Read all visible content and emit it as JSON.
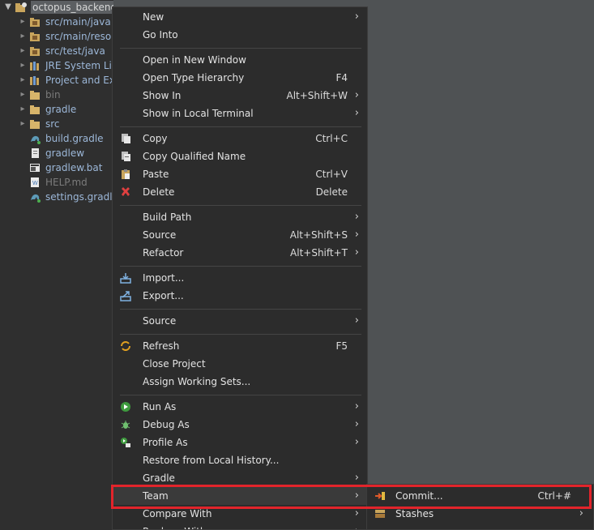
{
  "explorer": {
    "root": {
      "label": "octopus_backend [boot] [devtools] [octopus_backend main]"
    },
    "items": [
      {
        "label": "src/main/java",
        "icon": "source-folder-icon",
        "dim": false
      },
      {
        "label": "src/main/resources",
        "icon": "source-folder-icon",
        "dim": false
      },
      {
        "label": "src/test/java",
        "icon": "source-folder-icon",
        "dim": false
      },
      {
        "label": "JRE System Library",
        "icon": "library-icon",
        "dim": false
      },
      {
        "label": "Project and External Dependencies",
        "icon": "library-icon",
        "dim": false
      },
      {
        "label": "bin",
        "icon": "folder-icon",
        "dim": true
      },
      {
        "label": "gradle",
        "icon": "folder-icon",
        "dim": false
      },
      {
        "label": "src",
        "icon": "folder-icon",
        "dim": false
      },
      {
        "label": "build.gradle",
        "icon": "gradle-file-icon",
        "dim": false
      },
      {
        "label": "gradlew",
        "icon": "file-icon",
        "dim": false
      },
      {
        "label": "gradlew.bat",
        "icon": "bat-file-icon",
        "dim": false
      },
      {
        "label": "HELP.md",
        "icon": "markdown-file-icon",
        "dim": true
      },
      {
        "label": "settings.gradle",
        "icon": "gradle-file-icon",
        "dim": false
      }
    ]
  },
  "menu": {
    "items": [
      {
        "label": "New",
        "accel": "",
        "submenu": true,
        "icon": ""
      },
      {
        "label": "Go Into",
        "accel": "",
        "submenu": false,
        "icon": ""
      },
      {
        "label": "Open in New Window",
        "accel": "",
        "submenu": false,
        "icon": ""
      },
      {
        "label": "Open Type Hierarchy",
        "accel": "F4",
        "submenu": false,
        "icon": ""
      },
      {
        "label": "Show In",
        "accel": "Alt+Shift+W",
        "submenu": true,
        "icon": ""
      },
      {
        "label": "Show in Local Terminal",
        "accel": "",
        "submenu": true,
        "icon": ""
      },
      {
        "label": "Copy",
        "accel": "Ctrl+C",
        "submenu": false,
        "icon": "copy-icon"
      },
      {
        "label": "Copy Qualified Name",
        "accel": "",
        "submenu": false,
        "icon": "copy-qualified-name-icon"
      },
      {
        "label": "Paste",
        "accel": "Ctrl+V",
        "submenu": false,
        "icon": "paste-icon"
      },
      {
        "label": "Delete",
        "accel": "Delete",
        "submenu": false,
        "icon": "delete-icon"
      },
      {
        "label": "Build Path",
        "accel": "",
        "submenu": true,
        "icon": ""
      },
      {
        "label": "Source",
        "accel": "Alt+Shift+S",
        "submenu": true,
        "icon": ""
      },
      {
        "label": "Refactor",
        "accel": "Alt+Shift+T",
        "submenu": true,
        "icon": ""
      },
      {
        "label": "Import...",
        "accel": "",
        "submenu": false,
        "icon": "import-icon"
      },
      {
        "label": "Export...",
        "accel": "",
        "submenu": false,
        "icon": "export-icon"
      },
      {
        "label": "Source",
        "accel": "",
        "submenu": true,
        "icon": ""
      },
      {
        "label": "Refresh",
        "accel": "F5",
        "submenu": false,
        "icon": "refresh-icon"
      },
      {
        "label": "Close Project",
        "accel": "",
        "submenu": false,
        "icon": ""
      },
      {
        "label": "Assign Working Sets...",
        "accel": "",
        "submenu": false,
        "icon": ""
      },
      {
        "label": "Run As",
        "accel": "",
        "submenu": true,
        "icon": "run-icon"
      },
      {
        "label": "Debug As",
        "accel": "",
        "submenu": true,
        "icon": "debug-icon"
      },
      {
        "label": "Profile As",
        "accel": "",
        "submenu": true,
        "icon": "profile-icon"
      },
      {
        "label": "Restore from Local History...",
        "accel": "",
        "submenu": false,
        "icon": ""
      },
      {
        "label": "Gradle",
        "accel": "",
        "submenu": true,
        "icon": ""
      },
      {
        "label": "Team",
        "accel": "",
        "submenu": true,
        "icon": ""
      },
      {
        "label": "Compare With",
        "accel": "",
        "submenu": true,
        "icon": ""
      },
      {
        "label": "Replace With",
        "accel": "",
        "submenu": true,
        "icon": ""
      }
    ]
  },
  "team_submenu": {
    "items": [
      {
        "label": "Commit...",
        "accel": "Ctrl+#",
        "submenu": false,
        "icon": "commit-icon"
      },
      {
        "label": "Stashes",
        "accel": "",
        "submenu": true,
        "icon": "stashes-icon"
      }
    ]
  },
  "colors": {
    "highlight": "#e2242b",
    "menu_bg": "#2c2c2c",
    "tree_text": "#9cb7d8"
  }
}
